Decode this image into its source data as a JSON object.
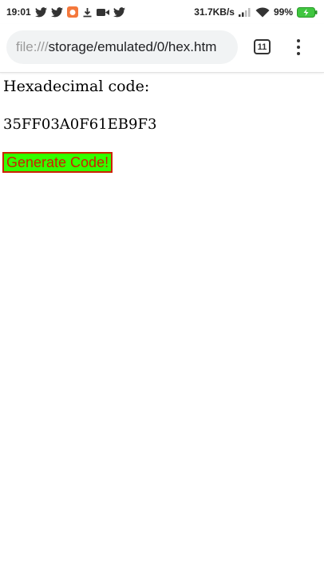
{
  "status_bar": {
    "time": "19:01",
    "network_speed": "31.7KB/s",
    "battery": "99%",
    "left_icons": [
      "twitter-icon",
      "twitter-icon",
      "app-icon",
      "download-icon",
      "video-icon",
      "twitter-icon"
    ],
    "right_icons": [
      "signal-icon",
      "wifi-icon",
      "battery-charging-icon"
    ]
  },
  "browser": {
    "url_scheme": "file",
    "url_separator": ":///",
    "url_path": "storage/emulated/0/hex.htm",
    "tab_count": "11"
  },
  "page": {
    "heading": "Hexadecimal code:",
    "hex_value": "35FF03A0F61EB9F3",
    "button_label": "Generate Code!",
    "colors": {
      "button_background": "#33ff00",
      "button_text": "#cc2200",
      "button_border": "#cc2200"
    }
  }
}
